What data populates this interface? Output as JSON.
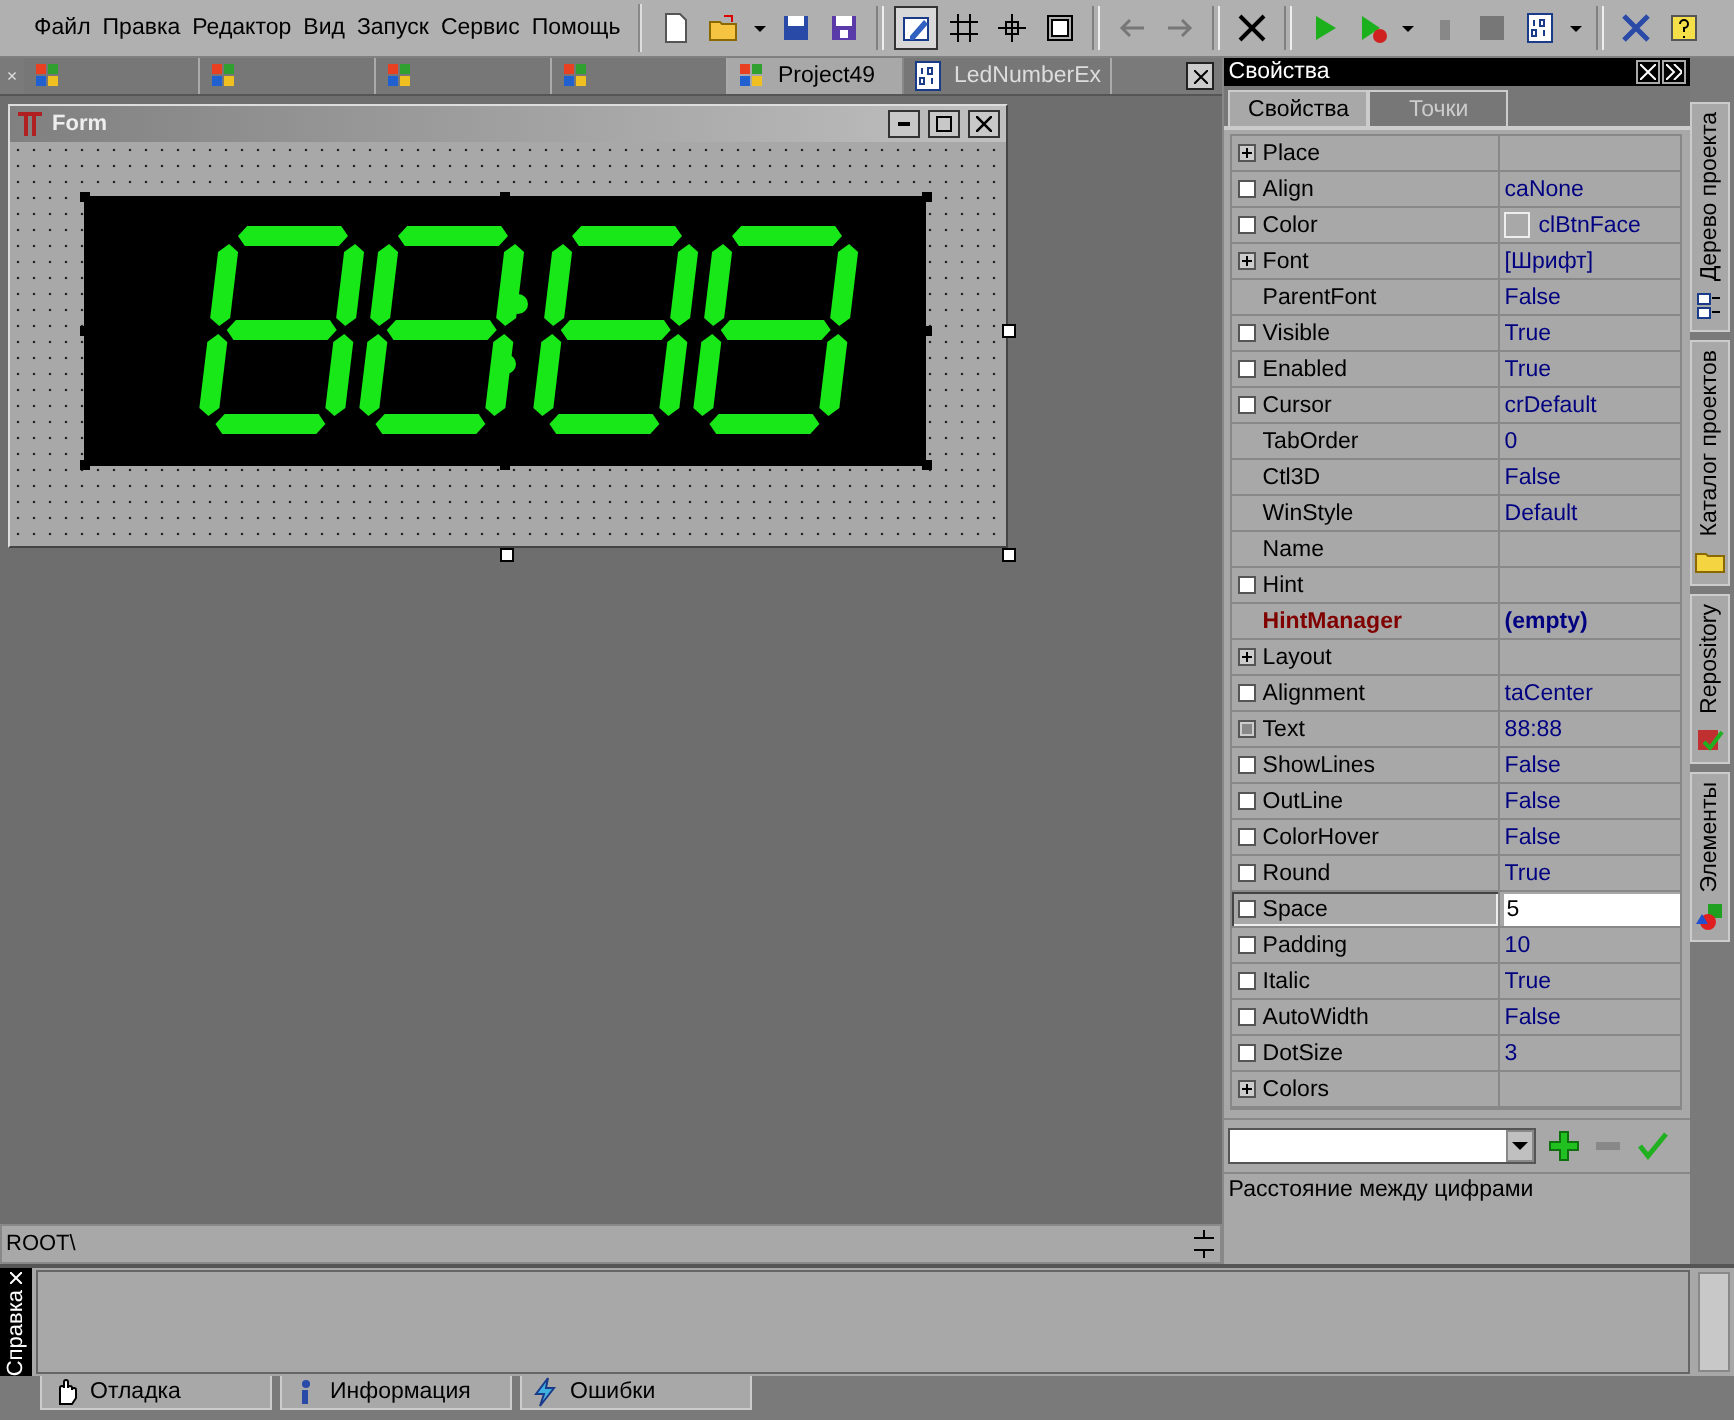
{
  "menu": [
    "Файл",
    "Правка",
    "Редактор",
    "Вид",
    "Запуск",
    "Сервис",
    "Помощь"
  ],
  "toolbar": [
    {
      "pressed": false
    },
    {
      "pressed": false
    },
    {
      "pressed": false
    },
    {
      "pressed": false
    },
    {
      "pressed": true
    },
    {
      "pressed": false
    },
    {
      "pressed": false
    },
    {
      "pressed": false
    },
    {
      "pressed": false
    },
    {
      "pressed": false
    },
    {
      "pressed": false
    },
    {
      "pressed": false
    },
    {
      "pressed": false
    },
    {
      "pressed": false
    },
    {
      "pressed": false
    },
    {
      "pressed": false
    },
    {
      "pressed": false
    },
    {
      "pressed": false
    }
  ],
  "doc_tabs": {
    "close": "×",
    "tabs": [
      {
        "selected": false
      },
      {
        "selected": false
      },
      {
        "selected": false
      },
      {
        "selected": false
      },
      {
        "label": "Project49",
        "selected": true
      },
      {
        "label": "LedNumberEx",
        "selected": false
      }
    ]
  },
  "form": {
    "title": "Form"
  },
  "path_bar": {
    "text": "ROOT\\"
  },
  "properties_panel": {
    "title": "Свойства",
    "tabs": [
      {
        "label": "Свойства",
        "selected": true
      },
      {
        "label": "Точки",
        "selected": false
      }
    ],
    "rows": [
      {
        "kind": "group",
        "name": "Place",
        "value": "",
        "selected": false
      },
      {
        "kind": "checkbox",
        "name": "Align",
        "value": "caNone",
        "selected": false
      },
      {
        "kind": "checkbox",
        "name": "Color",
        "value": "clBtnFace",
        "swatch": true,
        "selected": false
      },
      {
        "kind": "group",
        "name": "Font",
        "value": "[Шрифт]",
        "selected": false
      },
      {
        "kind": "plain",
        "name": "ParentFont",
        "value": "False",
        "selected": false
      },
      {
        "kind": "checkbox",
        "name": "Visible",
        "value": "True",
        "selected": false
      },
      {
        "kind": "checkbox",
        "name": "Enabled",
        "value": "True",
        "selected": false
      },
      {
        "kind": "checkbox",
        "name": "Cursor",
        "value": "crDefault",
        "selected": false
      },
      {
        "kind": "plain",
        "name": "TabOrder",
        "value": "0",
        "selected": false
      },
      {
        "kind": "plain",
        "name": "Ctl3D",
        "value": "False",
        "selected": false
      },
      {
        "kind": "plain",
        "name": "WinStyle",
        "value": "Default",
        "selected": false
      },
      {
        "kind": "plain",
        "name": "Name",
        "value": "",
        "selected": false
      },
      {
        "kind": "checkbox",
        "name": "Hint",
        "value": "",
        "selected": false
      },
      {
        "kind": "plain",
        "name": "HintManager",
        "value": "(empty)",
        "emphasized": true,
        "selected": false
      },
      {
        "kind": "group",
        "name": "Layout",
        "value": "",
        "selected": false
      },
      {
        "kind": "checkbox",
        "name": "Alignment",
        "value": "taCenter",
        "selected": false
      },
      {
        "kind": "boxed",
        "name": "Text",
        "value": "88:88",
        "selected": false
      },
      {
        "kind": "checkbox",
        "name": "ShowLines",
        "value": "False",
        "selected": false
      },
      {
        "kind": "checkbox",
        "name": "OutLine",
        "value": "False",
        "selected": false
      },
      {
        "kind": "checkbox",
        "name": "ColorHover",
        "value": "False",
        "selected": false
      },
      {
        "kind": "checkbox",
        "name": "Round",
        "value": "True",
        "selected": false
      },
      {
        "kind": "checkbox",
        "name": "Space",
        "value": "5",
        "selected": true
      },
      {
        "kind": "checkbox",
        "name": "Padding",
        "value": "10",
        "selected": false
      },
      {
        "kind": "checkbox",
        "name": "Italic",
        "value": "True",
        "selected": false
      },
      {
        "kind": "checkbox",
        "name": "AutoWidth",
        "value": "False",
        "selected": false
      },
      {
        "kind": "checkbox",
        "name": "DotSize",
        "value": "3",
        "selected": false
      },
      {
        "kind": "group",
        "name": "Colors",
        "value": "",
        "selected": false
      }
    ],
    "description": "Расстояние между цифрами"
  },
  "side_tabs": [
    "Дерево проекта",
    "Каталог проектов",
    "Repository",
    "Элементы"
  ],
  "help_pane": {
    "title": "Справка"
  },
  "bottom_tabs": [
    "Отладка",
    "Информация",
    "Ошибки"
  ]
}
